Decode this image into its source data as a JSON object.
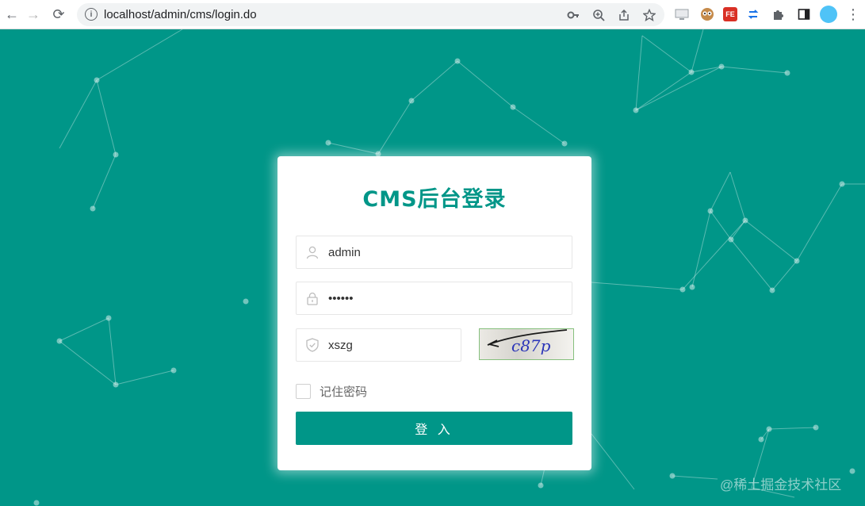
{
  "browser": {
    "url": "localhost/admin/cms/login.do",
    "nav": {
      "back": "←",
      "forward": "→",
      "reload": "⟳"
    },
    "omnibox_icons": [
      "key-icon",
      "zoom-icon",
      "share-icon",
      "star-icon"
    ],
    "extension_icons": [
      "ext-screen-icon",
      "ext-owl-icon",
      "ext-fe-icon",
      "ext-sync-icon",
      "puzzle-icon",
      "sidepanel-icon",
      "profile-avatar",
      "menu-icon"
    ],
    "ext_fe_label": "FE"
  },
  "login": {
    "title": "CMS后台登录",
    "username_value": "admin",
    "password_value": "••••••",
    "captcha_value": "xszg",
    "captcha_image_text": "c87p",
    "remember_label": "记住密码",
    "submit_label": "登 入"
  },
  "colors": {
    "primary": "#009688",
    "background": "#009688",
    "card": "#ffffff"
  },
  "watermark": "@稀土掘金技术社区"
}
